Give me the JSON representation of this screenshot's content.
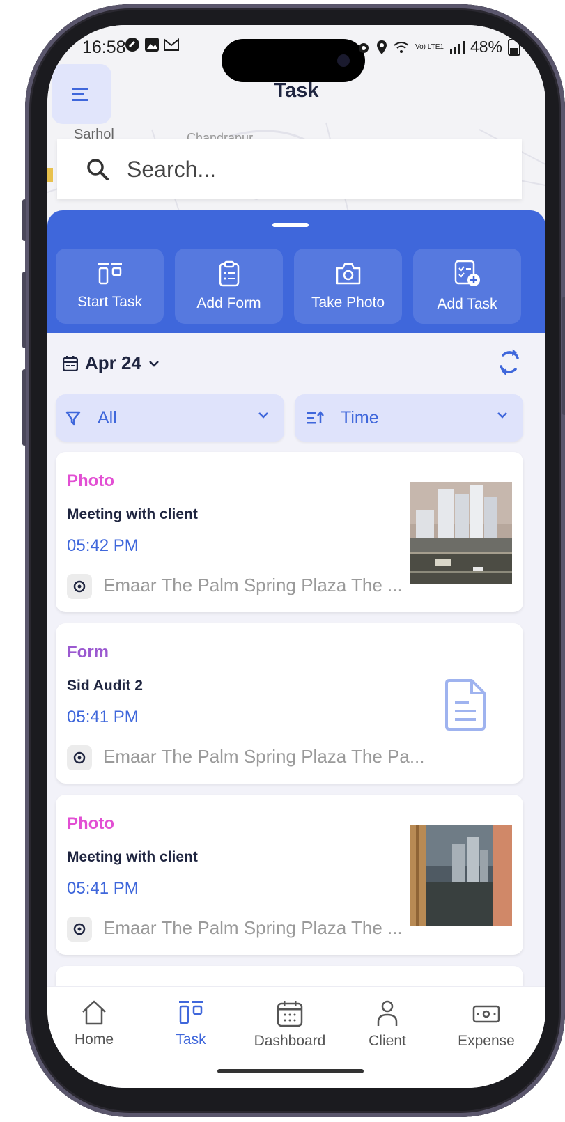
{
  "status_bar": {
    "time": "16:58",
    "battery": "48%",
    "network": "Vo) LTE1"
  },
  "header": {
    "title": "Task",
    "menu_icon": "hamburger-icon"
  },
  "map": {
    "labels": [
      "Sarhol",
      "Chandrapur"
    ]
  },
  "search": {
    "placeholder": "Search..."
  },
  "quick_actions": [
    {
      "label": "Start Task",
      "icon": "start-task-icon"
    },
    {
      "label": "Add Form",
      "icon": "clipboard-icon"
    },
    {
      "label": "Take Photo",
      "icon": "camera-icon"
    },
    {
      "label": "Add Task",
      "icon": "add-task-icon"
    }
  ],
  "date_selector": {
    "label": "Apr 24"
  },
  "filters": {
    "type_label": "All",
    "sort_label": "Time"
  },
  "tasks": [
    {
      "type": "Photo",
      "title": "Meeting with client",
      "time": "05:42 PM",
      "location": "Emaar The Palm Spring Plaza The ...",
      "thumbnail": "photo"
    },
    {
      "type": "Form",
      "title": "Sid Audit 2",
      "time": "05:41 PM",
      "location": "Emaar The Palm Spring Plaza The Pa...",
      "thumbnail": "form-icon"
    },
    {
      "type": "Photo",
      "title": "Meeting with client",
      "time": "05:41 PM",
      "location": "Emaar The Palm Spring Plaza The ...",
      "thumbnail": "photo"
    }
  ],
  "bottom_nav": [
    {
      "label": "Home",
      "icon": "home-icon",
      "active": false
    },
    {
      "label": "Task",
      "icon": "task-icon",
      "active": true
    },
    {
      "label": "Dashboard",
      "icon": "calendar-icon",
      "active": false
    },
    {
      "label": "Client",
      "icon": "person-icon",
      "active": false
    },
    {
      "label": "Expense",
      "icon": "money-icon",
      "active": false
    }
  ],
  "colors": {
    "primary": "#3f67db",
    "photo_type": "#e24fd3",
    "form_type": "#9b59d0",
    "background": "#f2f2f9"
  }
}
